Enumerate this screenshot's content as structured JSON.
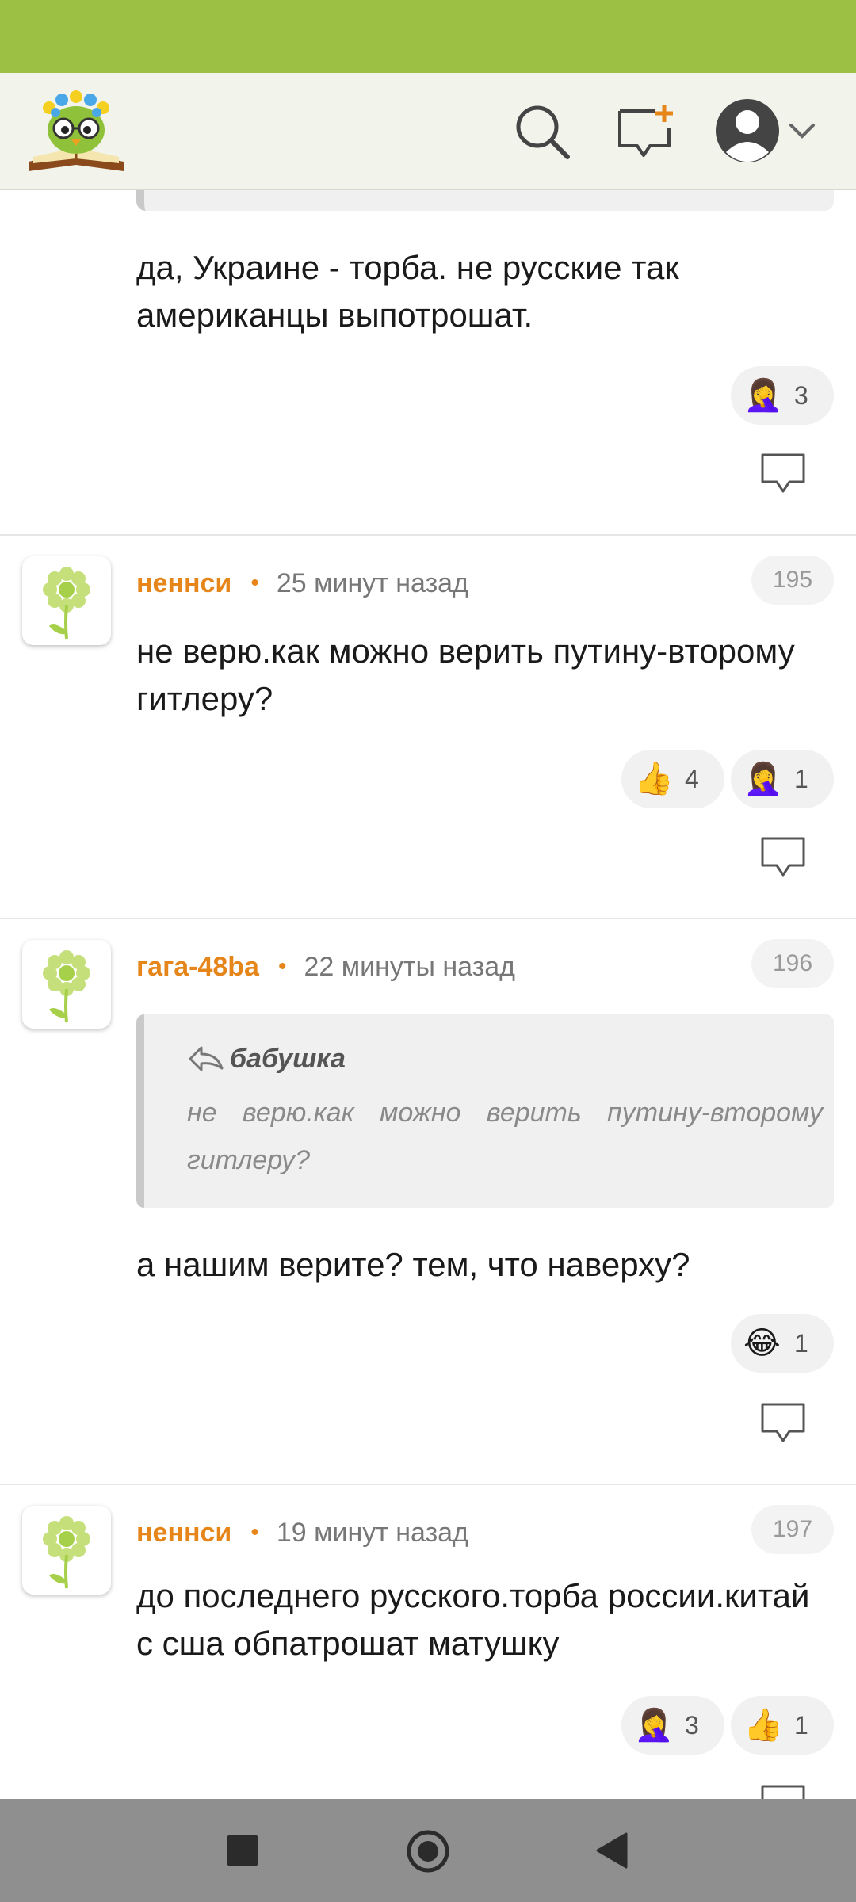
{
  "header": {
    "logo": "owl-logo-icon",
    "icons": [
      "search-icon",
      "new-message-icon",
      "avatar-icon",
      "chevron-down-icon"
    ]
  },
  "comments": [
    {
      "text": "да, Украине - торба. не русские так американцы выпотрошат.",
      "reactions": [
        {
          "emoji": "🤦‍♀️",
          "count": "3"
        }
      ]
    },
    {
      "author": "неннси",
      "time": "25 минут назад",
      "number": "195",
      "text": "не верю.как можно верить путину-второму гитлеру?",
      "reactions": [
        {
          "emoji": "👍",
          "count": "4"
        },
        {
          "emoji": "🤦‍♀️",
          "count": "1"
        }
      ]
    },
    {
      "author": "гага-48ba",
      "time": "22 минуты назад",
      "number": "196",
      "quote": {
        "author": "бабушка",
        "text": "не верю.как можно верить путину-второму гитлеру?"
      },
      "text": "а нашим верите? тем, что наверху?",
      "reactions": [
        {
          "emoji": "😂",
          "count": "1"
        }
      ]
    },
    {
      "author": "неннси",
      "time": "19 минут назад",
      "number": "197",
      "text": "до последнего русского.торба россии.китай с сша обпатрошат матушку",
      "reactions": [
        {
          "emoji": "🤦‍♀️",
          "count": "3"
        },
        {
          "emoji": "👍",
          "count": "1"
        }
      ]
    }
  ],
  "meta_separator": "•",
  "colors": {
    "status_bar": "#9bc043",
    "header_bg": "#f2f3eb",
    "author": "#e5851a",
    "nav_bar": "#8f8f8f"
  }
}
